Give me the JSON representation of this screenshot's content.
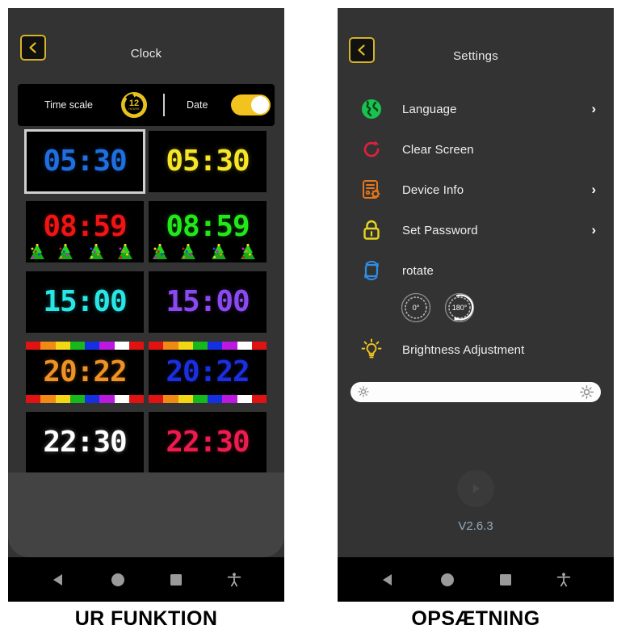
{
  "clock_screen": {
    "title": "Clock",
    "back_icon": "chevron-left-icon",
    "options": {
      "time_scale_label": "Time scale",
      "time_scale_badge_number": "12",
      "time_scale_badge_sub": "HOURS",
      "date_label": "Date",
      "date_toggle_state": "on"
    },
    "thumbnails": [
      {
        "time": "05:30",
        "digit_color": "#1f6fe0",
        "border_style": "checker-rainbow",
        "selected": true,
        "decor": "none"
      },
      {
        "time": "05:30",
        "digit_color": "#f7e627",
        "border_style": "checker-rainbow",
        "selected": false,
        "decor": "none"
      },
      {
        "time": "08:59",
        "digit_color": "#f01414",
        "border_style": "none",
        "selected": false,
        "decor": "christmas-trees"
      },
      {
        "time": "08:59",
        "digit_color": "#22e819",
        "border_style": "none",
        "selected": false,
        "decor": "christmas-trees"
      },
      {
        "time": "15:00",
        "digit_color": "#28e6e6",
        "border_style": "checker-neon",
        "selected": false,
        "decor": "none"
      },
      {
        "time": "15:00",
        "digit_color": "#8b49f0",
        "border_style": "checker-neon",
        "selected": false,
        "decor": "none"
      },
      {
        "time": "20:22",
        "digit_color": "#f09123",
        "border_style": "stripe-rainbow",
        "selected": false,
        "decor": "none"
      },
      {
        "time": "20:22",
        "digit_color": "#1b2fe0",
        "border_style": "stripe-rainbow",
        "selected": false,
        "decor": "none"
      },
      {
        "time": "22:30",
        "digit_color": "#ffffff",
        "border_style": "checker-greencyan",
        "selected": false,
        "decor": "none"
      },
      {
        "time": "22:30",
        "digit_color": "#ef1b4e",
        "border_style": "checker-greencyan",
        "selected": false,
        "decor": "none"
      }
    ],
    "nav": {
      "back": "nav-back-icon",
      "home": "nav-home-icon",
      "recents": "nav-recents-icon",
      "accessibility": "nav-accessibility-icon"
    },
    "caption": "UR FUNKTION"
  },
  "settings_screen": {
    "title": "Settings",
    "back_icon": "chevron-left-icon",
    "items": [
      {
        "label": "Language",
        "icon": "globe-icon",
        "icon_color": "#19c24f",
        "chevron": true
      },
      {
        "label": "Clear Screen",
        "icon": "refresh-icon",
        "icon_color": "#e0203f",
        "chevron": false
      },
      {
        "label": "Device Info",
        "icon": "device-info-icon",
        "icon_color": "#e5761b",
        "chevron": true
      },
      {
        "label": "Set Password",
        "icon": "lock-icon",
        "icon_color": "#e8d51c",
        "chevron": true
      },
      {
        "label": "rotate",
        "icon": "rotate-icon",
        "icon_color": "#2e8fe8",
        "chevron": false
      },
      {
        "label": "Brightness Adjustment",
        "icon": "lightbulb-icon",
        "icon_color": "#edc41c",
        "chevron": false
      }
    ],
    "rotation_options": [
      {
        "label": "0°",
        "selected": false
      },
      {
        "label": "180°",
        "selected": true
      }
    ],
    "brightness": {
      "value_percent": 100,
      "left_icon": "sun-small-icon",
      "right_icon": "sun-large-icon"
    },
    "version": "V2.6.3",
    "nav": {
      "back": "nav-back-icon",
      "home": "nav-home-icon",
      "recents": "nav-recents-icon",
      "accessibility": "nav-accessibility-icon"
    },
    "caption": "OPSÆTNING"
  },
  "colors": {
    "accent_yellow": "#e8c21b",
    "phone_bg": "#333333",
    "navbar_bg": "#000000",
    "version_text": "#94a9bd"
  }
}
